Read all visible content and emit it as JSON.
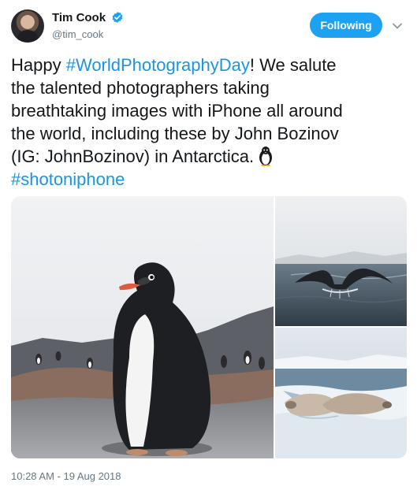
{
  "author": {
    "display_name": "Tim Cook",
    "handle": "@tim_cook",
    "verified": true,
    "avatar_icon": "profile-photo"
  },
  "follow_button": {
    "label": "Following",
    "color": "#1da1f2"
  },
  "menu_icon": "chevron-down-icon",
  "tweet": {
    "text_parts": [
      {
        "text": "Happy ",
        "type": "text"
      },
      {
        "text": "#WorldPhotographyDay",
        "type": "hashtag"
      },
      {
        "text": "! We salute\nthe talented photographers taking\nbreathtaking images with iPhone all around\nthe world, including these by John Bozinov\n(IG: JohnBozinov) in Antarctica.",
        "type": "text"
      },
      {
        "text": "\n",
        "type": "text"
      },
      {
        "text": "#shotoniphone",
        "type": "hashtag"
      }
    ],
    "emoji": "penguin-icon",
    "hashtag_color": "#1b95e0"
  },
  "media": [
    {
      "subject": "penguin-chick"
    },
    {
      "subject": "whale-tail"
    },
    {
      "subject": "seals-on-ice"
    }
  ],
  "timestamp": "10:28 AM - 19 Aug 2018"
}
